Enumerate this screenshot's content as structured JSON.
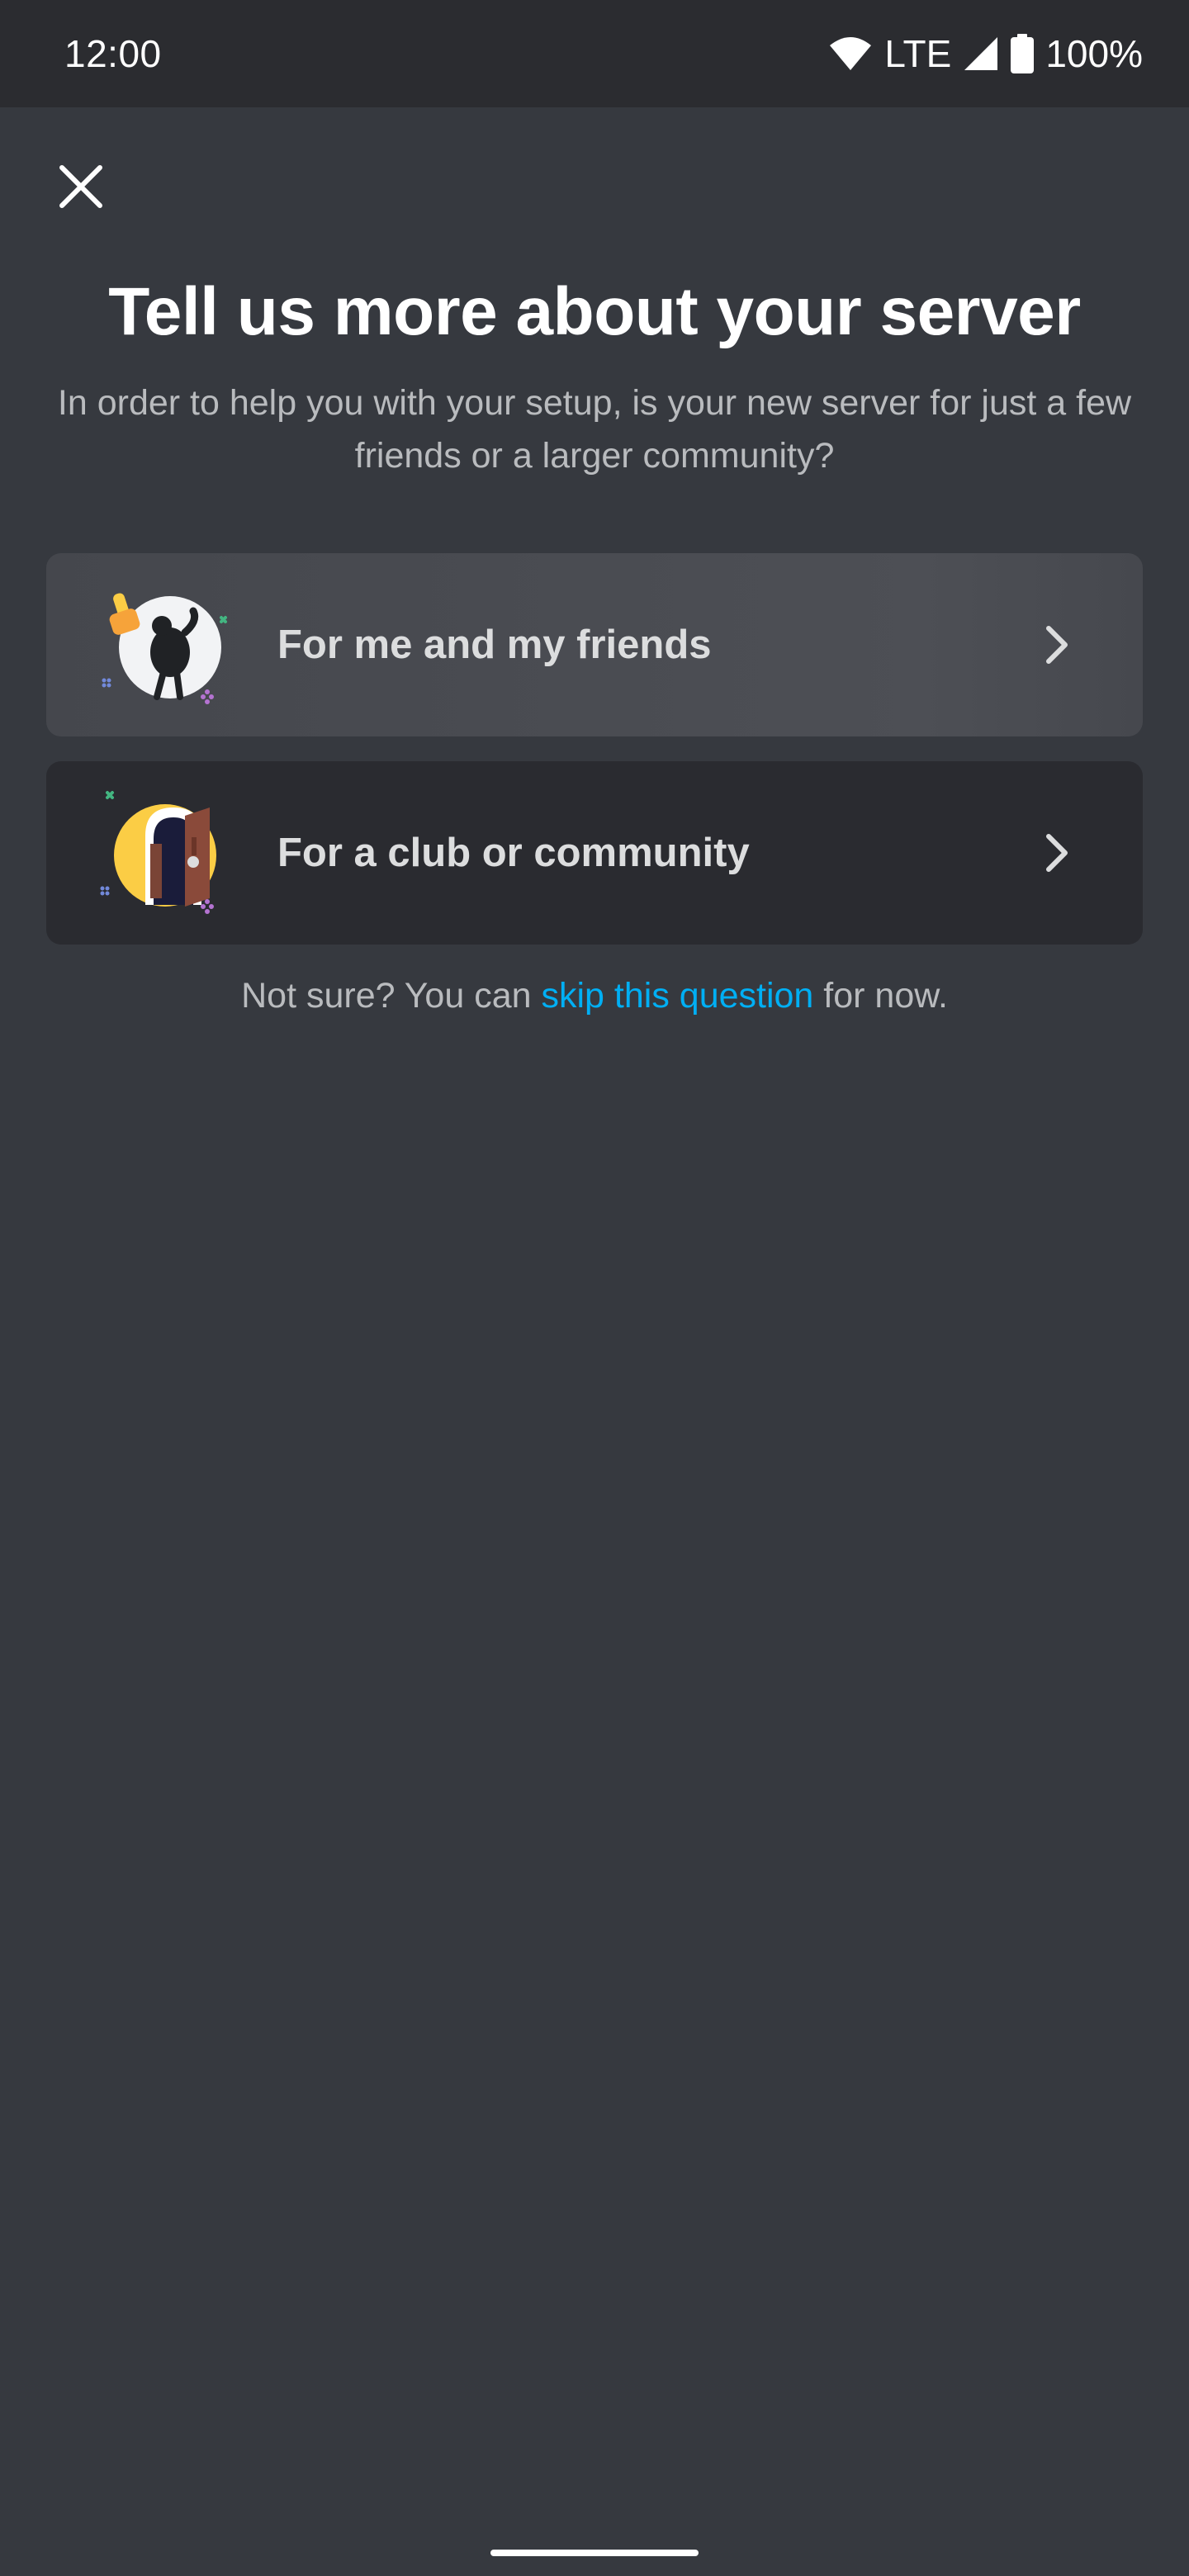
{
  "status_bar": {
    "time": "12:00",
    "network": "LTE",
    "battery": "100%",
    "icons": [
      "wifi-icon",
      "cell-signal-icon",
      "battery-icon"
    ]
  },
  "header": {
    "close_icon": "close-icon",
    "title": "Tell us more about your server",
    "subtitle": "In order to help you with your setup, is your new server for just a few friends or a larger community?"
  },
  "options": [
    {
      "label": "For me and my friends",
      "icon": "friends-illustration",
      "chevron": "chevron-right-icon"
    },
    {
      "label": "For a club or community",
      "icon": "community-door-illustration",
      "chevron": "chevron-right-icon"
    }
  ],
  "note": {
    "prefix": "Not sure? You can ",
    "link": "skip this question",
    "suffix": " for now."
  },
  "colors": {
    "background": "#36393f",
    "status_bar": "#2b2c30",
    "card_selected": "#4a4c52",
    "card": "#2a2b30",
    "link": "#00aff4",
    "accent_yellow": "#fbcd45"
  }
}
